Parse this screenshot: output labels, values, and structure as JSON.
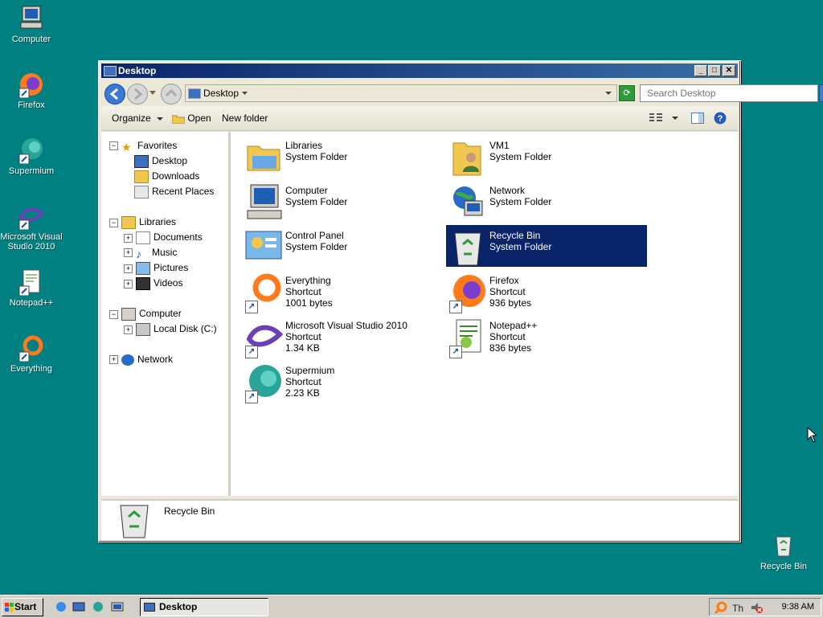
{
  "desktop": {
    "icons": [
      {
        "label": "Computer"
      },
      {
        "label": "Firefox"
      },
      {
        "label": "Supermium"
      },
      {
        "label": "Microsoft Visual Studio 2010"
      },
      {
        "label": "Notepad++"
      },
      {
        "label": "Everything"
      },
      {
        "label": "Recycle Bin"
      }
    ]
  },
  "window": {
    "title": "Desktop",
    "address": "Desktop",
    "search_placeholder": "Search Desktop",
    "toolbar": {
      "organize": "Organize",
      "open": "Open",
      "new_folder": "New folder"
    },
    "tree": [
      {
        "label": "Favorites"
      },
      {
        "label": "Desktop"
      },
      {
        "label": "Downloads"
      },
      {
        "label": "Recent Places"
      },
      {
        "label": "Libraries"
      },
      {
        "label": "Documents"
      },
      {
        "label": "Music"
      },
      {
        "label": "Pictures"
      },
      {
        "label": "Videos"
      },
      {
        "label": "Computer"
      },
      {
        "label": "Local Disk (C:)"
      },
      {
        "label": "Network"
      }
    ],
    "items": [
      {
        "name": "Libraries",
        "type": "System Folder",
        "size": ""
      },
      {
        "name": "VM1",
        "type": "System Folder",
        "size": ""
      },
      {
        "name": "Computer",
        "type": "System Folder",
        "size": ""
      },
      {
        "name": "Network",
        "type": "System Folder",
        "size": ""
      },
      {
        "name": "Control Panel",
        "type": "System Folder",
        "size": ""
      },
      {
        "name": "Recycle Bin",
        "type": "System Folder",
        "size": ""
      },
      {
        "name": "Everything",
        "type": "Shortcut",
        "size": "1001 bytes"
      },
      {
        "name": "Firefox",
        "type": "Shortcut",
        "size": "936 bytes"
      },
      {
        "name": "Microsoft Visual Studio 2010",
        "type": "Shortcut",
        "size": "1.34 KB"
      },
      {
        "name": "Notepad++",
        "type": "Shortcut",
        "size": "836 bytes"
      },
      {
        "name": "Supermium",
        "type": "Shortcut",
        "size": "2.23 KB"
      }
    ],
    "details": {
      "name": "Recycle Bin"
    }
  },
  "taskbar": {
    "start": "Start",
    "task": "Desktop",
    "clock": "9:38 AM"
  }
}
